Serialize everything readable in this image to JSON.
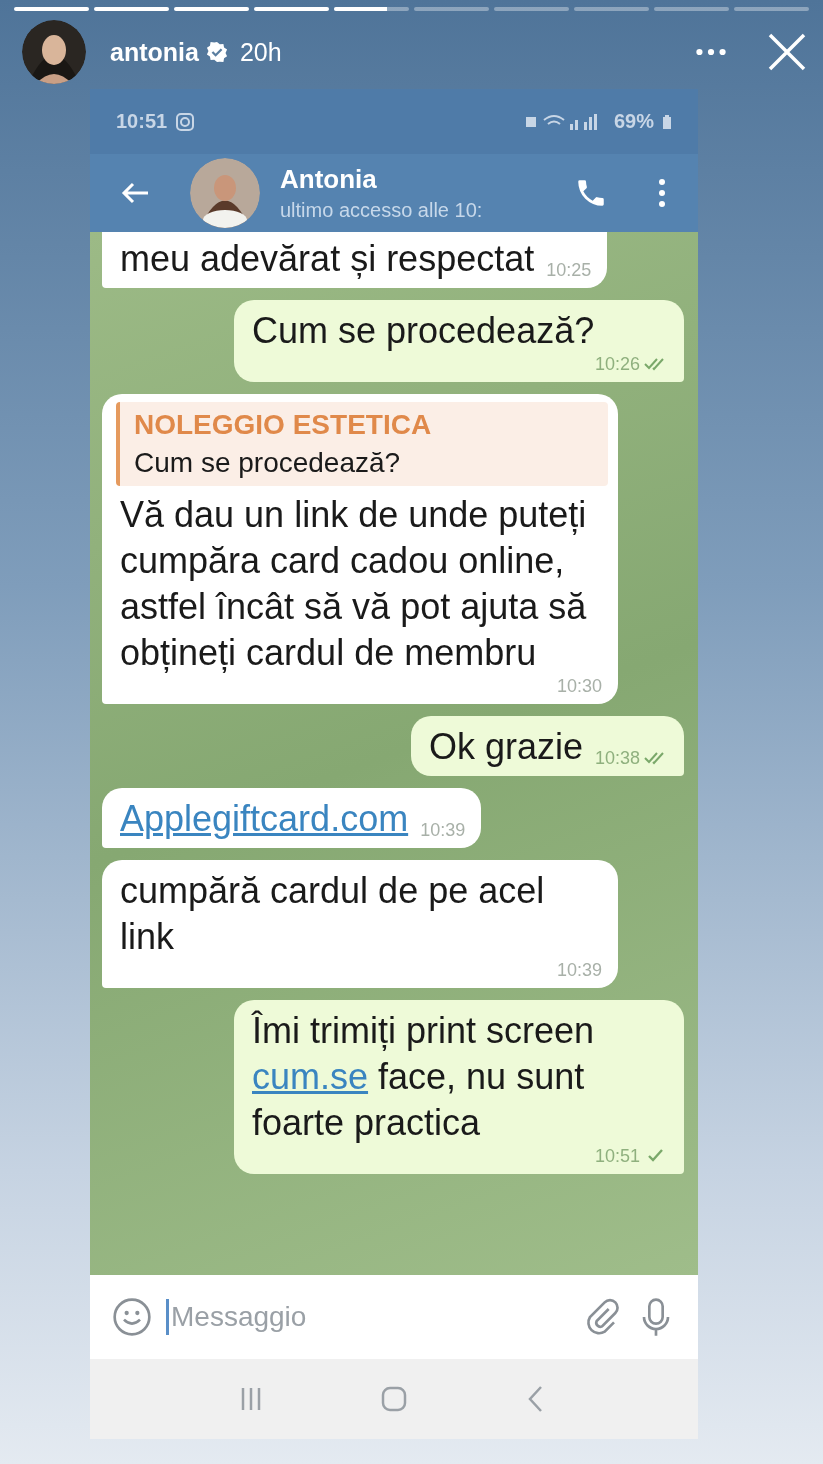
{
  "story": {
    "progress": [
      {
        "level": 1
      },
      {
        "level": 1
      },
      {
        "level": 1
      },
      {
        "level": 1
      },
      {
        "level": 0.7
      },
      {
        "level": 0
      },
      {
        "level": 0
      },
      {
        "level": 0
      },
      {
        "level": 0
      },
      {
        "level": 0
      }
    ],
    "username": "antonia",
    "verified": true,
    "age": "20h"
  },
  "phone": {
    "status_time": "10:51",
    "battery": "69%"
  },
  "chat": {
    "name": "Antonia",
    "last_seen": "ultimo accesso alle 10:",
    "messages": [
      {
        "kind": "incoming",
        "parts": [
          {
            "text": "meu adevărat și respectat",
            "link": false
          }
        ],
        "time": "10:25"
      },
      {
        "kind": "outgoing",
        "parts": [
          {
            "text": "Cum se procedează?",
            "link": false
          }
        ],
        "time": "10:26",
        "read": true
      },
      {
        "kind": "incoming",
        "reply": {
          "author": "NOLEGGIO ESTETICA",
          "text": "Cum se procedează?"
        },
        "parts": [
          {
            "text": "Vă dau un link de unde puteți cumpăra card cadou online, astfel încât să vă pot ajuta să obțineți cardul de membru",
            "link": false
          }
        ],
        "time": "10:30"
      },
      {
        "kind": "outgoing",
        "parts": [
          {
            "text": "Ok grazie",
            "link": false
          }
        ],
        "time": "10:38",
        "read": true
      },
      {
        "kind": "incoming",
        "parts": [
          {
            "text": "Applegiftcard.com",
            "link": true
          }
        ],
        "time": "10:39"
      },
      {
        "kind": "incoming",
        "parts": [
          {
            "text": "cumpără cardul de pe acel link",
            "link": false
          }
        ],
        "time": "10:39"
      },
      {
        "kind": "outgoing",
        "parts": [
          {
            "text": "Îmi trimiți print screen ",
            "link": false
          },
          {
            "text": "cum.se",
            "link": true
          },
          {
            "text": " face, nu sunt foarte practica",
            "link": false
          }
        ],
        "time": "10:51",
        "read": false
      }
    ],
    "input": {
      "placeholder": "Messaggio"
    }
  }
}
